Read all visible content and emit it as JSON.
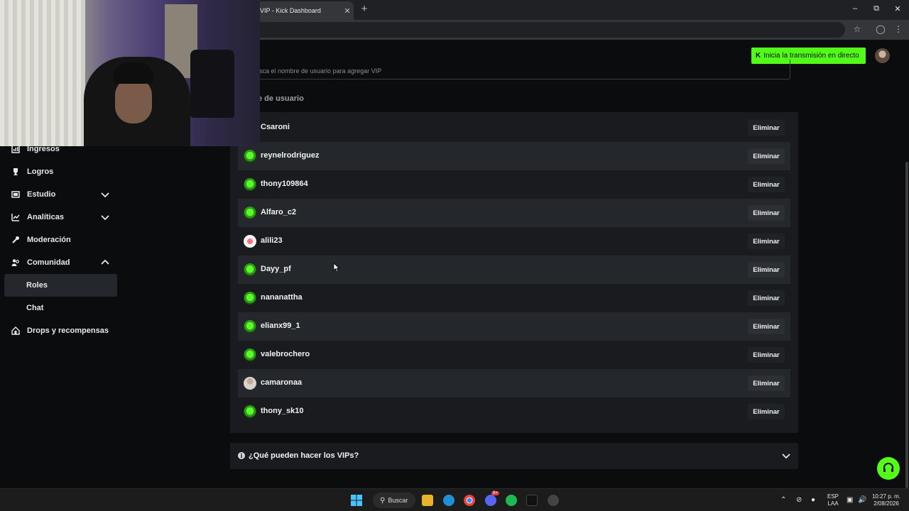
{
  "browser": {
    "tab_title": "VIP - Kick Dashboard",
    "tab_close": "✕",
    "new_tab": "+"
  },
  "header": {
    "live_button": "Inicia la transmisión en directo",
    "live_icon": "K"
  },
  "sidebar": {
    "items": [
      {
        "label": "Ingresos",
        "icon": "income-icon"
      },
      {
        "label": "Logros",
        "icon": "trophy-icon"
      },
      {
        "label": "Estudio",
        "icon": "studio-icon"
      },
      {
        "label": "Analíticas",
        "icon": "analytics-icon"
      },
      {
        "label": "Moderación",
        "icon": "wrench-icon"
      },
      {
        "label": "Comunidad",
        "icon": "community-icon"
      },
      {
        "label": "Roles"
      },
      {
        "label": "Chat"
      },
      {
        "label": "Drops y recompensas",
        "icon": "drops-icon"
      }
    ]
  },
  "search": {
    "placeholder": "usca el nombre de usuario para agregar VIP"
  },
  "list": {
    "column_header": "bre de usuario",
    "remove_label": "Eliminar",
    "vips": [
      {
        "name": "Csaroni",
        "avatar": "green"
      },
      {
        "name": "reynelrodriguez",
        "avatar": "green"
      },
      {
        "name": "thony109864",
        "avatar": "green"
      },
      {
        "name": "Alfaro_c2",
        "avatar": "green"
      },
      {
        "name": "alili23",
        "avatar": "pink"
      },
      {
        "name": "Dayy_pf",
        "avatar": "green"
      },
      {
        "name": "nananattha",
        "avatar": "green"
      },
      {
        "name": "elianx99_1",
        "avatar": "green"
      },
      {
        "name": "valebrochero",
        "avatar": "green"
      },
      {
        "name": "camaronaa",
        "avatar": "person"
      },
      {
        "name": "thony_sk10",
        "avatar": "green"
      }
    ]
  },
  "faq": {
    "label": "¿Qué pueden hacer los VIPs?",
    "info": "i"
  },
  "taskbar": {
    "search_label": "Buscar",
    "language_top": "ESP",
    "language_bottom": "LAA",
    "time": "10:27 p. m.",
    "date": "2/08/2026",
    "discord_badge": "9+"
  },
  "colors": {
    "accent": "#53fc18",
    "panel": "#191b1f",
    "row_alt": "#24272b",
    "page_bg": "#0b0c0d"
  }
}
